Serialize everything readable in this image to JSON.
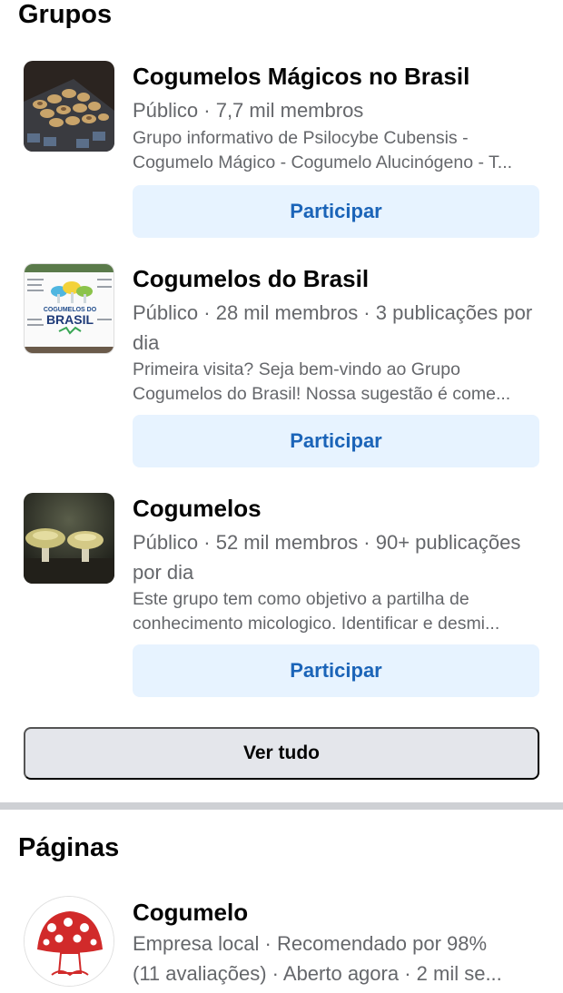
{
  "groups_section": {
    "title": "Grupos",
    "see_all_label": "Ver tudo",
    "items": [
      {
        "name": "Cogumelos Mágicos no Brasil",
        "meta": "Público · 7,7 mil membros",
        "description_lines": [
          "Grupo informativo de Psilocybe Cubensis -",
          "Cogumelo Mágico - Cogumelo Alucinógeno - T..."
        ],
        "join_label": "Participar",
        "thumbnail_icon": "mushroom-tray-photo"
      },
      {
        "name": "Cogumelos do Brasil",
        "meta": "Público · 28 mil membros · 3 publicações por dia",
        "description_lines": [
          "Primeira visita? Seja bem-vindo ao Grupo",
          "Cogumelos do Brasil! Nossa sugestão é come..."
        ],
        "join_label": "Participar",
        "thumbnail_icon": "cogumelos-do-brasil-logo",
        "thumbnail_text_1": "COGUMELOS DO",
        "thumbnail_text_2": "BRASIL"
      },
      {
        "name": "Cogumelos",
        "meta": "Público · 52 mil membros · 90+ publicações por dia",
        "description_lines": [
          "Este grupo tem como objetivo a partilha de",
          "conhecimento micologico. Identificar e desmi..."
        ],
        "join_label": "Participar",
        "thumbnail_icon": "wild-mushrooms-photo"
      }
    ]
  },
  "pages_section": {
    "title": "Páginas",
    "items": [
      {
        "name": "Cogumelo",
        "meta_lines": [
          "Empresa local · Recomendado por 98%",
          "(11 avaliações) · Aberto agora · 2 mil se..."
        ],
        "avatar_icon": "red-mushroom-logo"
      }
    ]
  },
  "colors": {
    "join_button_bg": "#e7f3ff",
    "join_button_text": "#1b64b8",
    "secondary_text": "#65676b",
    "see_all_bg": "#e4e6eb",
    "divider": "#ced0d4"
  }
}
